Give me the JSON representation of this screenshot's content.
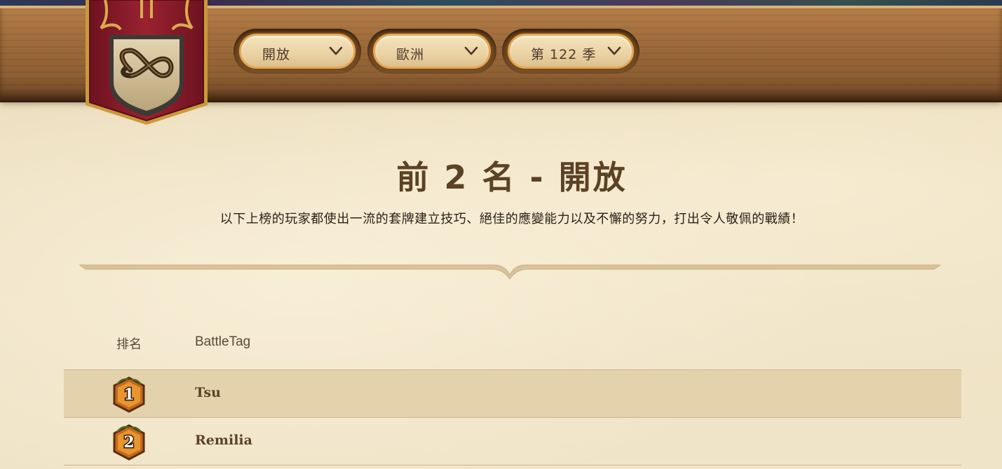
{
  "filters": {
    "mode": "開放",
    "region": "歐洲",
    "season": "第 122 季"
  },
  "heading": {
    "title": "前 2 名 - 開放",
    "subtitle": "以下上榜的玩家都使出一流的套牌建立技巧、絕佳的應變能力以及不懈的努力，打出令人敬佩的戰績！"
  },
  "table": {
    "columns": [
      "排名",
      "BattleTag"
    ],
    "rows": [
      {
        "rank": "1",
        "battletag": "Tsu"
      },
      {
        "rank": "2",
        "battletag": "Remilia"
      }
    ]
  },
  "icons": {
    "banner": "infinity-shield-icon",
    "dropdown": "chevron-down-icon",
    "rank_badge": "rank-badge-icon"
  },
  "colors": {
    "banner_red": "#8e1c2a",
    "gold_trim": "#d9ab4e",
    "title_brown": "#5c4224",
    "highlight_row": "#e4d2ac"
  }
}
